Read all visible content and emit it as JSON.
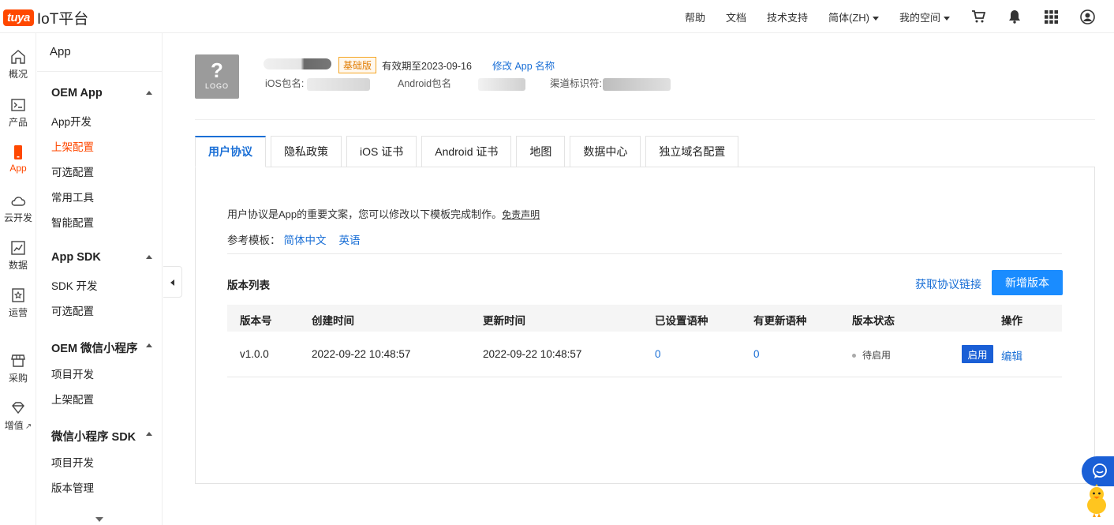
{
  "brand": {
    "badge": "tuya",
    "name": "IoT平台"
  },
  "topnav": {
    "help": "帮助",
    "docs": "文档",
    "support": "技术支持",
    "language": "简体(ZH)",
    "workspace": "我的空间"
  },
  "rail": {
    "items": [
      {
        "label": "概况",
        "icon": "home-icon"
      },
      {
        "label": "产品",
        "icon": "terminal-icon"
      },
      {
        "label": "App",
        "icon": "phone-icon"
      },
      {
        "label": "云开发",
        "icon": "cloud-icon"
      },
      {
        "label": "数据",
        "icon": "chart-icon"
      },
      {
        "label": "运营",
        "icon": "bookmark-star-icon"
      },
      {
        "label": "采购",
        "icon": "shop-icon"
      },
      {
        "label": "增值",
        "icon": "diamond-icon"
      }
    ]
  },
  "subnav": {
    "title": "App",
    "groups": [
      {
        "title": "OEM App",
        "items": [
          "App开发",
          "上架配置",
          "可选配置",
          "常用工具",
          "智能配置"
        ]
      },
      {
        "title": "App SDK",
        "items": [
          "SDK 开发",
          "可选配置"
        ]
      },
      {
        "title": "OEM 微信小程序",
        "items": [
          "项目开发",
          "上架配置"
        ]
      },
      {
        "title": "微信小程序 SDK",
        "items": [
          "项目开发",
          "版本管理"
        ]
      }
    ]
  },
  "app": {
    "logo_label": "LOGO",
    "plan": "基础版",
    "expire": "有效期至2023-09-16",
    "rename": "修改 App 名称",
    "ios_label": "iOS包名:",
    "android_label": "Android包名",
    "channel_label": "渠道标识符:"
  },
  "tabs": [
    "用户协议",
    "隐私政策",
    "iOS 证书",
    "Android 证书",
    "地图",
    "数据中心",
    "独立域名配置"
  ],
  "agreement": {
    "intro": "用户协议是App的重要文案，您可以修改以下模板完成制作。",
    "disclaimer": "免责声明",
    "template_label": "参考模板：",
    "template_zh": "简体中文",
    "template_en": "英语"
  },
  "versions": {
    "title": "版本列表",
    "get_link": "获取协议链接",
    "new_button": "新增版本",
    "columns": [
      "版本号",
      "创建时间",
      "更新时间",
      "已设置语种",
      "有更新语种",
      "版本状态",
      "操作"
    ],
    "rows": [
      {
        "version": "v1.0.0",
        "created": "2022-09-22 10:48:57",
        "updated": "2022-09-22 10:48:57",
        "set_langs": "0",
        "updated_langs": "0",
        "status": "待启用",
        "enable": "启用",
        "edit": "编辑"
      }
    ]
  },
  "colors": {
    "accent": "#1a6fd6",
    "brand": "#ff4800",
    "plan_badge": "#e07b00"
  }
}
